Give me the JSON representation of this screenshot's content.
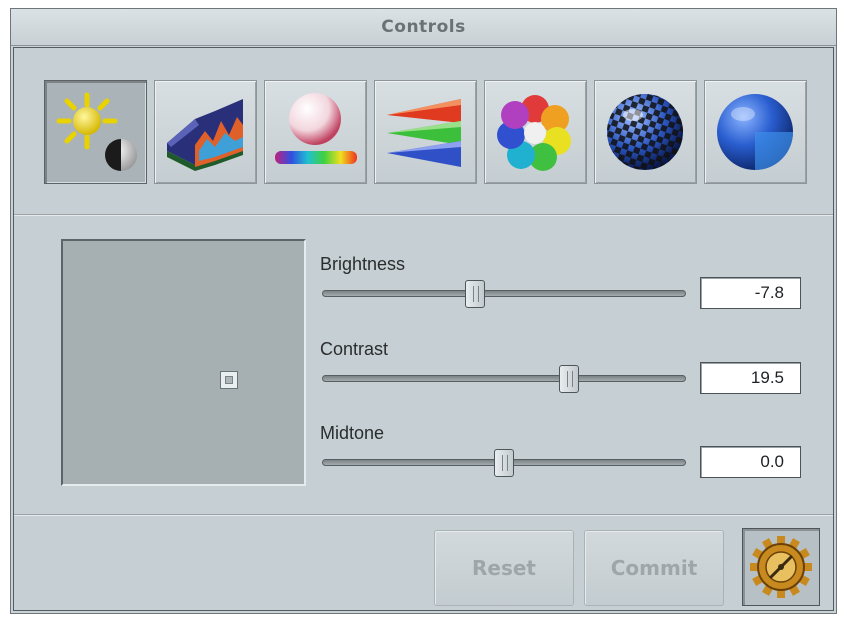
{
  "window": {
    "title": "Controls"
  },
  "toolbar": {
    "selected_index": 0,
    "buttons": [
      {
        "icon": "brightness-sun-icon"
      },
      {
        "icon": "histogram-curve-icon"
      },
      {
        "icon": "color-sphere-icon"
      },
      {
        "icon": "rgb-channels-icon"
      },
      {
        "icon": "color-wheel-icon"
      },
      {
        "icon": "checker-sphere-icon"
      },
      {
        "icon": "textured-sphere-icon"
      }
    ]
  },
  "sliders": {
    "brightness": {
      "label": "Brightness",
      "value": "-7.8",
      "position_fraction": 0.42
    },
    "contrast": {
      "label": "Contrast",
      "value": "19.5",
      "position_fraction": 0.68
    },
    "midtone": {
      "label": "Midtone",
      "value": "0.0",
      "position_fraction": 0.5
    }
  },
  "buttons": {
    "reset_label": "Reset",
    "commit_label": "Commit",
    "settings_icon": "gear-compass-icon"
  },
  "colors": {
    "background": "#c6cfd3",
    "title_text": "#6b7276",
    "disabled_text": "#9ea6aa",
    "gear_gold": "#c88a1e"
  }
}
